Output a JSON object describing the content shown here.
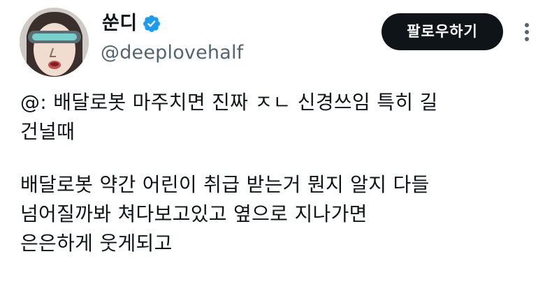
{
  "user": {
    "display_name": "쑨디",
    "handle": "@deeplovehalf",
    "verified": true,
    "avatar_icon": "avatar-face-with-visor",
    "verified_icon": "verified-check-icon",
    "verified_color": "#1d9bf0"
  },
  "actions": {
    "follow_label": "팔로우하기",
    "more_icon": "more-vertical-icon"
  },
  "tweet": {
    "paragraphs": [
      {
        "lines": [
          "@: 배달로봇 마주치면 진짜 ㅈㄴ 신경쓰임 특히 길",
          "건널때"
        ]
      },
      {
        "lines": [
          "배달로봇 약간 어린이 취급 받는거 뭔지 알지 다들",
          "넘어질까봐 쳐다보고있고 옆으로 지나가면",
          "은은하게 웃게되고"
        ]
      }
    ]
  },
  "colors": {
    "text": "#0f1419",
    "secondary_text": "#536471",
    "follow_bg": "#0f1419",
    "follow_text": "#ffffff"
  }
}
